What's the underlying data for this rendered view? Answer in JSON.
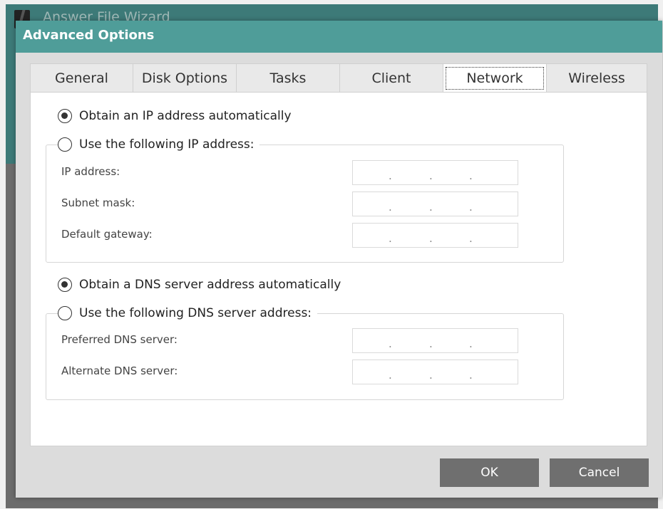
{
  "background_window": {
    "title": "Answer File Wizard"
  },
  "dialog": {
    "title": "Advanced Options"
  },
  "tabs": [
    {
      "label": "General",
      "active": false
    },
    {
      "label": "Disk Options",
      "active": false
    },
    {
      "label": "Tasks",
      "active": false
    },
    {
      "label": "Client",
      "active": false
    },
    {
      "label": "Network",
      "active": true
    },
    {
      "label": "Wireless",
      "active": false
    }
  ],
  "ip_section": {
    "auto_label": "Obtain an IP address automatically",
    "auto_selected": true,
    "manual_label": "Use the following IP address:",
    "manual_selected": false,
    "fields": [
      {
        "label": "IP address:",
        "value": ""
      },
      {
        "label": "Subnet mask:",
        "value": ""
      },
      {
        "label": "Default gateway:",
        "value": ""
      }
    ]
  },
  "dns_section": {
    "auto_label": "Obtain a DNS server address automatically",
    "auto_selected": true,
    "manual_label": "Use the following DNS server address:",
    "manual_selected": false,
    "fields": [
      {
        "label": "Preferred DNS server:",
        "value": ""
      },
      {
        "label": "Alternate DNS server:",
        "value": ""
      }
    ]
  },
  "buttons": {
    "ok": "OK",
    "cancel": "Cancel"
  },
  "ip_separator": ".",
  "colors": {
    "titlebar": "#4f9d99",
    "button": "#6f6f6f"
  }
}
